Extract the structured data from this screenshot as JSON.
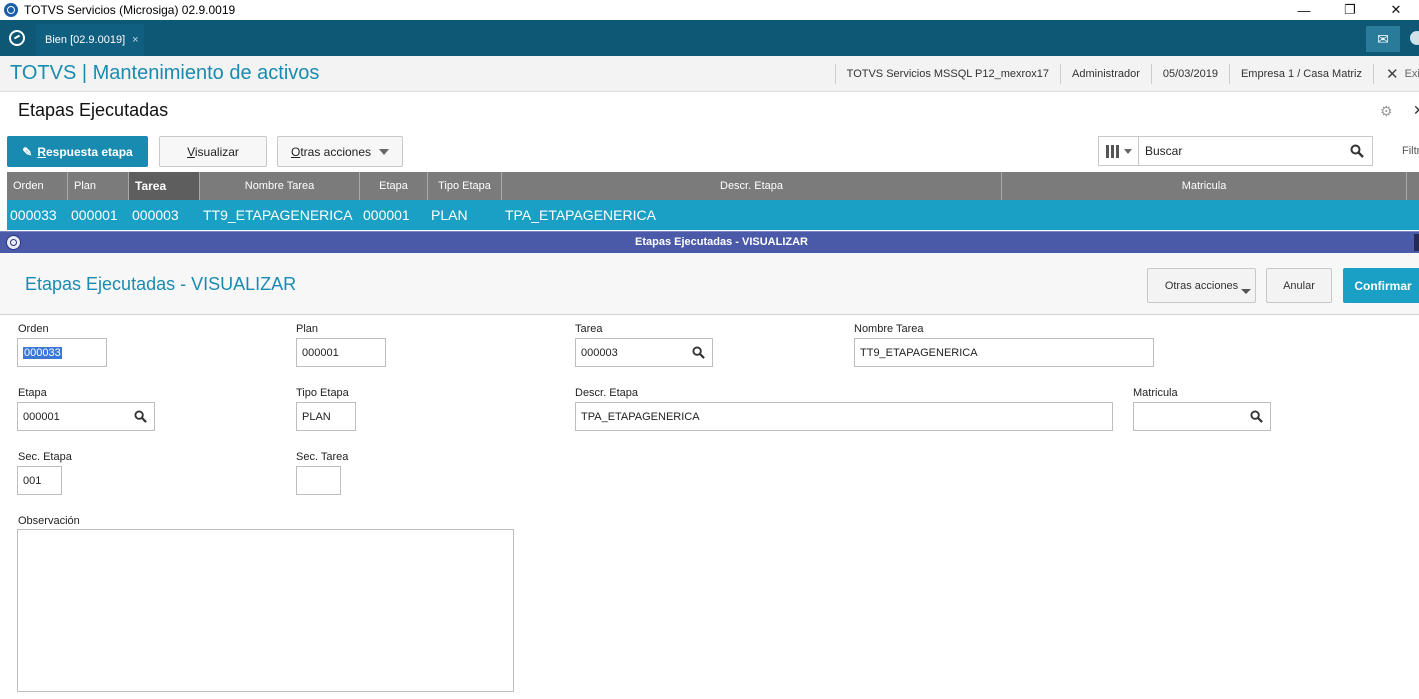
{
  "window": {
    "title": "TOTVS Servicios (Microsiga) 02.9.0019",
    "controls": {
      "minimize": "—",
      "restore": "❐",
      "close": "✕"
    }
  },
  "tabbar": {
    "active_tab": "Bien [02.9.0019]",
    "tab_close": "×",
    "mail_glyph": "✉"
  },
  "app": {
    "title": "TOTVS | Mantenimiento de activos",
    "info": [
      "TOTVS Servicios MSSQL P12_mexrox17",
      "Administrador",
      "05/03/2019",
      "Empresa 1 / Casa Matriz"
    ],
    "exit_x": "✕",
    "exit_label": "Exit"
  },
  "browse": {
    "title": "Etapas Ejecutadas",
    "gear_glyph": "⚙",
    "close_glyph": "✕",
    "btn_respuesta_u": "R",
    "btn_respuesta_rest": "espuesta etapa",
    "btn_visualizar_u": "V",
    "btn_visualizar_rest": "isualizar",
    "btn_otras_u": "O",
    "btn_otras_rest": "tras acciones",
    "search_value": "Buscar",
    "filter_label": "Filtrar",
    "columns": [
      "Orden",
      "Plan",
      "Tarea",
      "Nombre Tarea",
      "Etapa",
      "Tipo Etapa",
      "Descr. Etapa",
      "Matricula"
    ],
    "row": [
      "000033",
      "000001",
      "000003",
      "TT9_ETAPAGENERICA",
      "000001",
      "PLAN",
      "TPA_ETAPAGENERICA",
      ""
    ]
  },
  "dialog": {
    "window_title": "Etapas Ejecutadas - VISUALIZAR",
    "header_title": "Etapas Ejecutadas - VISUALIZAR",
    "btn_otras": "Otras acciones",
    "btn_anular": "Anular",
    "btn_confirmar": "Confirmar",
    "fields": {
      "orden": {
        "label": "Orden",
        "value": "000033"
      },
      "plan": {
        "label": "Plan",
        "value": "000001"
      },
      "tarea": {
        "label": "Tarea",
        "value": "000003"
      },
      "nombre_tarea": {
        "label": "Nombre Tarea",
        "value": "TT9_ETAPAGENERICA"
      },
      "etapa": {
        "label": "Etapa",
        "value": "000001"
      },
      "tipo_etapa": {
        "label": "Tipo Etapa",
        "value": "PLAN"
      },
      "descr_etapa": {
        "label": "Descr. Etapa",
        "value": "TPA_ETAPAGENERICA"
      },
      "matricula": {
        "label": "Matricula",
        "value": ""
      },
      "sec_etapa": {
        "label": "Sec. Etapa",
        "value": "001"
      },
      "sec_tarea": {
        "label": "Sec. Tarea",
        "value": ""
      },
      "observacion": {
        "label": "Observación",
        "value": ""
      }
    }
  }
}
